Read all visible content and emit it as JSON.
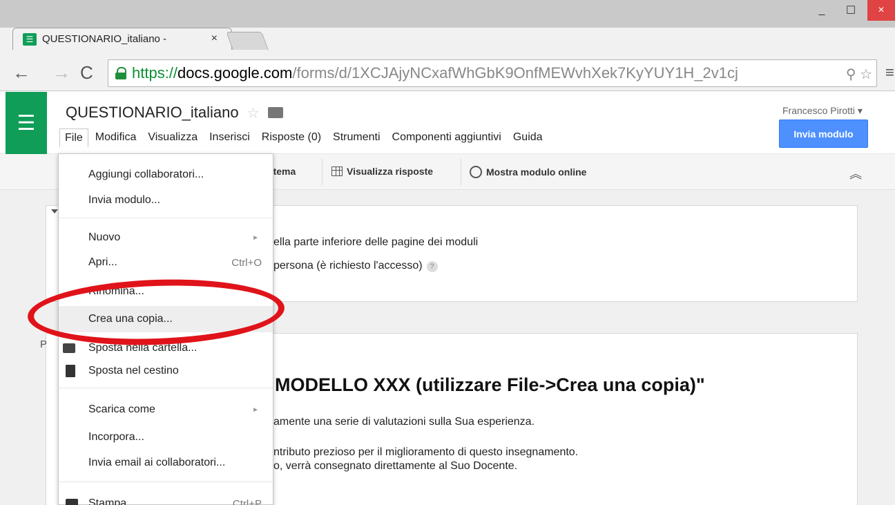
{
  "browser": {
    "tab_title": "QUESTIONARIO_italiano -",
    "tab_close": "×",
    "url_scheme": "https://",
    "url_host": "docs.google.com",
    "url_path": "/forms/d/1XCJAjyNCxafWhGbK9OnfMEWvhXek7KyYUY1H_2v1cj",
    "window_controls": {
      "minimize": "_",
      "maximize": "☐",
      "close": "×"
    },
    "icons": {
      "back": "arrow-left-icon",
      "forward": "arrow-right-icon",
      "reload": "reload-icon",
      "lock": "lock-icon",
      "zoom": "magnifier-icon",
      "bookmark": "star-icon",
      "menu": "hamburger-icon"
    }
  },
  "app": {
    "doc_title": "QUESTIONARIO_italiano",
    "user_name": "Francesco Pirotti ▾",
    "send_button": "Invia modulo",
    "menu": [
      "File",
      "Modifica",
      "Visualizza",
      "Inserisci",
      "Risposte (0)",
      "Strumenti",
      "Componenti aggiuntivi",
      "Guida"
    ],
    "accent_green": "#0f9d58",
    "accent_blue": "#4d90fe"
  },
  "edit_toolbar": {
    "theme_label": "ia tema",
    "view_responses": "Visualizza risposte",
    "show_online": "Mostra modulo online"
  },
  "file_menu": {
    "items": [
      {
        "label": "Aggiungi collaboratori..."
      },
      {
        "label": "Invia modulo..."
      },
      {
        "label": "Nuovo"
      },
      {
        "label": "Apri...",
        "shortcut": "Ctrl+O"
      },
      {
        "label": "Rinomina..."
      },
      {
        "label": "Crea una copia..."
      },
      {
        "label": "Sposta nella cartella..."
      },
      {
        "label": "Sposta nel cestino"
      },
      {
        "label": "Scarica come"
      },
      {
        "label": "Incorpora..."
      },
      {
        "label": "Invia email ai collaboratori..."
      },
      {
        "label": "Stampa",
        "shortcut": "Ctrl+P"
      }
    ]
  },
  "content": {
    "settings_line1": "ella parte inferiore delle pagine dei moduli",
    "settings_line2": "persona (è richiesto l'accesso)",
    "help": "?",
    "page_tag": "P",
    "form_heading": "MODELLO XXX (utilizzare File->Crea una copia)\"",
    "desc_line1": "amente una serie di valutazioni sulla Sua esperienza.",
    "desc_line2": "ntributo prezioso per il miglioramento di questo insegnamento.",
    "desc_line3": "o, verrà consegnato direttamente al Suo Docente."
  }
}
